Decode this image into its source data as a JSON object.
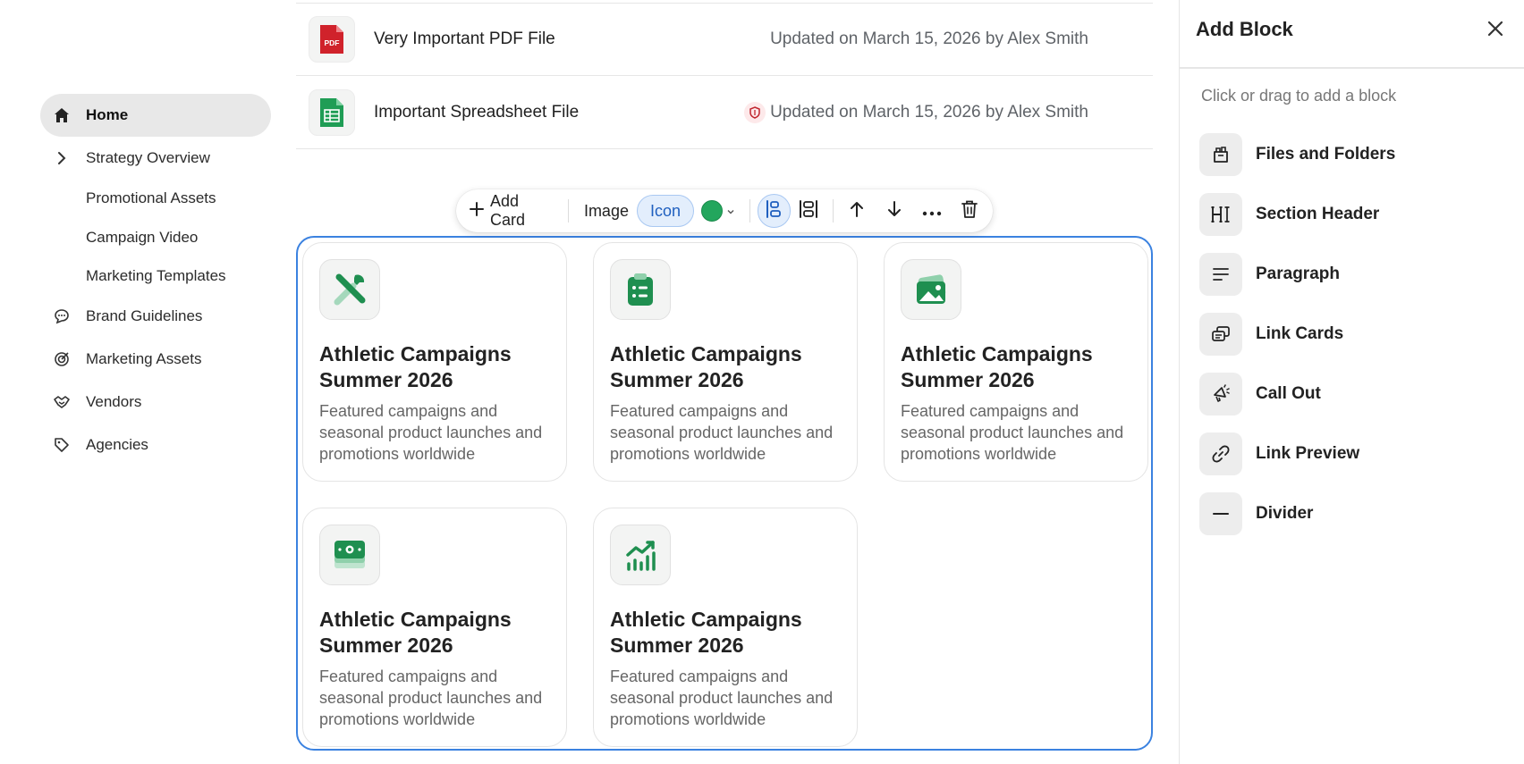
{
  "sidebar": {
    "items": [
      {
        "label": "Home",
        "icon": "home-icon"
      },
      {
        "label": "Strategy Overview",
        "icon": "chevron-right-icon"
      },
      {
        "label": "Promotional Assets"
      },
      {
        "label": "Campaign Video"
      },
      {
        "label": "Marketing Templates"
      },
      {
        "label": "Brand Guidelines",
        "icon": "chat-bubble-icon"
      },
      {
        "label": "Marketing Assets",
        "icon": "target-icon"
      },
      {
        "label": "Vendors",
        "icon": "handshake-icon"
      },
      {
        "label": "Agencies",
        "icon": "tag-icon"
      }
    ]
  },
  "files": [
    {
      "name": "Very Important PDF File",
      "meta": "Updated on March 15, 2026 by Alex Smith",
      "icon": "pdf-file-icon",
      "icon_text": "PDF"
    },
    {
      "name": "Important Spreadsheet File",
      "meta": "Updated on March 15, 2026 by Alex Smith",
      "icon": "spreadsheet-file-icon"
    }
  ],
  "toolbar": {
    "add_card": "Add Card",
    "image": "Image",
    "icon": "Icon",
    "color": "#23a65d"
  },
  "cards": [
    {
      "title": "Athletic Campaigns Summer 2026",
      "desc": "Featured campaigns and seasonal product launches and promotions worldwide",
      "icon": "tools-icon"
    },
    {
      "title": "Athletic Campaigns Summer 2026",
      "desc": "Featured campaigns and seasonal product launches and promotions worldwide",
      "icon": "clipboard-list-icon"
    },
    {
      "title": "Athletic Campaigns Summer 2026",
      "desc": "Featured campaigns and seasonal product launches and promotions worldwide",
      "icon": "image-icon"
    },
    {
      "title": "Athletic Campaigns Summer 2026",
      "desc": "Featured campaigns and seasonal product launches and promotions worldwide",
      "icon": "money-icon"
    },
    {
      "title": "Athletic Campaigns Summer 2026",
      "desc": "Featured campaigns and seasonal product launches and promotions worldwide",
      "icon": "chart-growth-icon"
    }
  ],
  "panel": {
    "title": "Add Block",
    "hint": "Click or drag to add a block",
    "blocks": [
      {
        "label": "Files and Folders",
        "icon": "folder-icon"
      },
      {
        "label": "Section Header",
        "icon": "header-icon"
      },
      {
        "label": "Paragraph",
        "icon": "paragraph-icon"
      },
      {
        "label": "Link Cards",
        "icon": "link-cards-icon"
      },
      {
        "label": "Call Out",
        "icon": "megaphone-icon"
      },
      {
        "label": "Link Preview",
        "icon": "link-icon"
      },
      {
        "label": "Divider",
        "icon": "divider-icon"
      }
    ]
  },
  "colors": {
    "accent": "#3b82e0",
    "brand_green": "#23a65d",
    "pdf_red": "#d0222b"
  }
}
